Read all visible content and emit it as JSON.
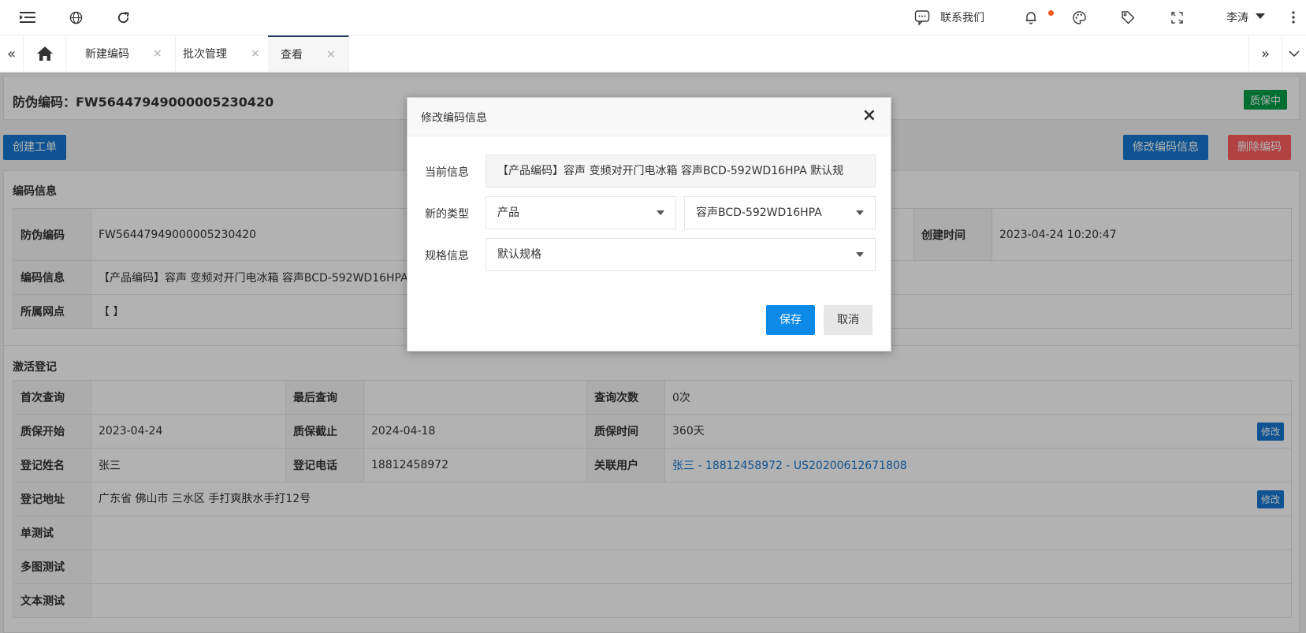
{
  "header": {
    "contact_label": "联系我们",
    "user_name": "李涛",
    "notification_dot_color": "#ff5722"
  },
  "tabs": {
    "items": [
      {
        "label": "新建编码"
      },
      {
        "label": "批次管理"
      },
      {
        "label": "查看"
      }
    ],
    "close_glyph": "×"
  },
  "page": {
    "code_title": "防伪编码：FW56447949000005230420",
    "status_badge": "质保中",
    "create_workorder_btn": "创建工单",
    "edit_code_btn": "修改编码信息",
    "delete_code_btn": "删除编码"
  },
  "code_info": {
    "section_title": "编码信息",
    "rows": [
      {
        "label": "防伪编码",
        "value": "FW56447949000005230420",
        "label2": "创建时间",
        "value2": "2023-04-24 10:20:47"
      },
      {
        "label": "编码信息",
        "value": "【产品编码】容声 变频对开门电冰箱 容声BCD-592WD16HPA 默认规格"
      },
      {
        "label": "所属网点",
        "value": "【 】"
      }
    ]
  },
  "activation": {
    "section_title": "激活登记",
    "r1": {
      "l1": "首次查询",
      "v1": "",
      "l2": "最后查询",
      "v2": "",
      "l3": "查询次数",
      "v3": "0次"
    },
    "r2": {
      "l1": "质保开始",
      "v1": "2023-04-24",
      "l2": "质保截止",
      "v2": "2024-04-18",
      "l3": "质保时间",
      "v3": "360天",
      "btn": "修改"
    },
    "r3": {
      "l1": "登记姓名",
      "v1": "张三",
      "l2": "登记电话",
      "v2": "18812458972",
      "l3": "关联用户",
      "v3": "张三 - 18812458972 - US20200612671808"
    },
    "r4": {
      "l1": "登记地址",
      "v1": "广东省 佛山市 三水区 手打爽肤水手打12号",
      "btn": "修改"
    },
    "r5": {
      "l1": "单测试",
      "v1": ""
    },
    "r6": {
      "l1": "多图测试",
      "v1": ""
    },
    "r7": {
      "l1": "文本测试",
      "v1": ""
    }
  },
  "dialog": {
    "title": "修改编码信息",
    "close_glyph": "×",
    "current_label": "当前信息",
    "current_value": "【产品编码】容声 变频对开门电冰箱 容声BCD-592WD16HPA 默认规",
    "type_label": "新的类型",
    "type_value": "产品",
    "product_value": "容声BCD-592WD16HPA",
    "spec_label": "规格信息",
    "spec_value": "默认规格",
    "save_btn": "保存",
    "cancel_btn": "取消"
  }
}
